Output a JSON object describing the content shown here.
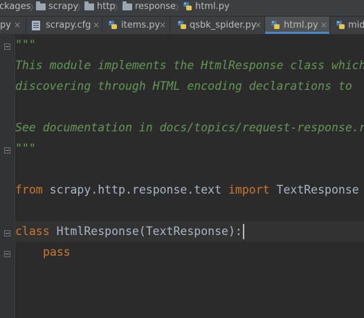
{
  "breadcrumb": [
    {
      "label": "ckages",
      "icon": "none"
    },
    {
      "label": "scrapy",
      "icon": "folder-icon"
    },
    {
      "label": "http",
      "icon": "folder-icon"
    },
    {
      "label": "response",
      "icon": "folder-icon"
    },
    {
      "label": "html.py",
      "icon": "python-file-icon"
    }
  ],
  "separator": "〉",
  "tabs": [
    {
      "label": "py",
      "icon": "none",
      "active": false
    },
    {
      "label": "scrapy.cfg",
      "icon": "config-file-icon",
      "active": false
    },
    {
      "label": "items.py",
      "icon": "python-file-icon",
      "active": false
    },
    {
      "label": "qsbk_spider.py",
      "icon": "python-file-icon",
      "active": false
    },
    {
      "label": "html.py",
      "icon": "python-file-icon",
      "active": true
    },
    {
      "label": "mid",
      "icon": "python-file-icon",
      "active": false
    }
  ],
  "close_glyph": "×",
  "code": {
    "doc_open": "\"\"\"",
    "doc_line1": "This module implements the HtmlResponse class which",
    "doc_line2": "discovering through HTML encoding declarations to",
    "doc_line3": "See documentation in docs/topics/request-response.rst",
    "doc_close": "\"\"\"",
    "import_from": "from",
    "import_module": " scrapy.http.response.text ",
    "import_kw": "import",
    "import_name": " TextResponse",
    "class_kw": "class",
    "class_decl": " HtmlResponse(TextResponse):",
    "pass_kw": "pass"
  },
  "colors": {
    "background": "#2b2b2b",
    "docstring": "#629755",
    "keyword": "#cc7832",
    "identifier": "#a9b7c6",
    "active_tab_underline": "#4a88c7"
  }
}
